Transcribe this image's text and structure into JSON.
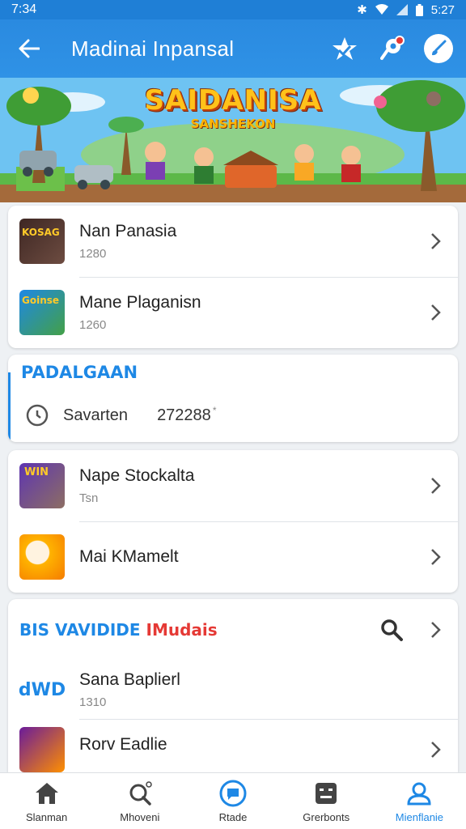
{
  "status_bar": {
    "time_left": "7:34",
    "time_right": "5:27"
  },
  "app_bar": {
    "title": "Madinai Inpansal"
  },
  "banner": {
    "logo": "SAIDANISA",
    "logo_sub": "SANSHEKON"
  },
  "list_top": [
    {
      "title": "Nan Panasia",
      "subtitle": "1280",
      "thumb_label": "KOSAG"
    },
    {
      "title": "Mane Plaganisn",
      "subtitle": "1260",
      "thumb_label": "Goinse"
    }
  ],
  "section_status": {
    "title": "PADALGAAN",
    "label": "Savarten",
    "value": "272288",
    "value_suffix": "*"
  },
  "list_mid": [
    {
      "title": "Nape Stockalta",
      "subtitle": "Tsn",
      "thumb_label": "WIN"
    },
    {
      "title": "Mai KMamelt",
      "subtitle": ""
    }
  ],
  "section_bottom": {
    "title_blue": "BIS VAVIDIDE",
    "title_red": "IMudais",
    "items": [
      {
        "title": "Sana Baplierl",
        "subtitle": "1310",
        "thumb_label": "dWD"
      },
      {
        "title": "Rorv Eadlie",
        "subtitle": ""
      }
    ]
  },
  "bottom_nav": [
    {
      "label": "Slanman",
      "icon": "home-icon"
    },
    {
      "label": "Mhoveni",
      "icon": "search-icon"
    },
    {
      "label": "Rtade",
      "icon": "chat-icon"
    },
    {
      "label": "Grerbonts",
      "icon": "robot-icon"
    },
    {
      "label": "Mienflanie",
      "icon": "profile-icon"
    }
  ],
  "colors": {
    "primary": "#2a8ae0",
    "accent": "#1e88e5",
    "red": "#e53935"
  }
}
